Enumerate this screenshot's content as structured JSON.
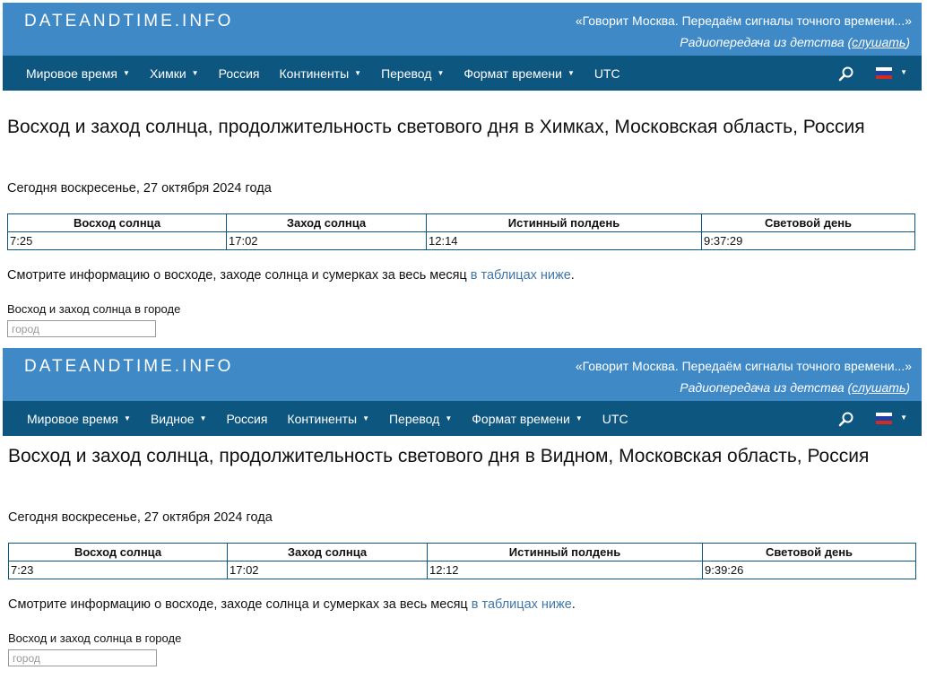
{
  "header": {
    "logo": "DATEANDTIME.INFO",
    "quote": "«Говорит Москва. Передаём сигналы точного времени...»",
    "subquote_text": "Радиопередача из детства (",
    "subquote_link": "слушать",
    "subquote_end": ")"
  },
  "colors": {
    "header_bg": "#3f8ac6",
    "nav_bg": "#0d5680",
    "link": "#3f76a8"
  },
  "icons": {
    "search": "search-icon",
    "flag": "russia-flag-icon"
  },
  "panels": [
    {
      "nav": [
        "Мировое время",
        "Химки",
        "Россия",
        "Континенты",
        "Перевод",
        "Формат времени",
        "UTC"
      ],
      "title": "Восход и заход солнца, продолжительность светового дня в Химках, Московская область, Россия",
      "today": "Сегодня воскресенье, 27 октября 2024 года",
      "table": {
        "headers": [
          "Восход солнца",
          "Заход солнца",
          "Истинный полдень",
          "Световой день"
        ],
        "values": [
          "7:25",
          "17:02",
          "12:14",
          "9:37:29"
        ]
      },
      "info_text": "Смотрите информацию о восходе, заходе солнца и сумерках за весь месяц ",
      "info_link": "в таблицах ниже",
      "info_end": ".",
      "city_label": "Восход и заход солнца в городе",
      "city_placeholder": "город"
    },
    {
      "nav": [
        "Мировое время",
        "Видное",
        "Россия",
        "Континенты",
        "Перевод",
        "Формат времени",
        "UTC"
      ],
      "title": "Восход и заход солнца, продолжительность светового дня в Видном, Московская область, Россия",
      "today": "Сегодня воскресенье, 27 октября 2024 года",
      "table": {
        "headers": [
          "Восход солнца",
          "Заход солнца",
          "Истинный полдень",
          "Световой день"
        ],
        "values": [
          "7:23",
          "17:02",
          "12:12",
          "9:39:26"
        ]
      },
      "info_text": "Смотрите информацию о восходе, заходе солнца и сумерках за весь месяц ",
      "info_link": "в таблицах ниже",
      "info_end": ".",
      "city_label": "Восход и заход солнца в городе",
      "city_placeholder": "город"
    }
  ]
}
